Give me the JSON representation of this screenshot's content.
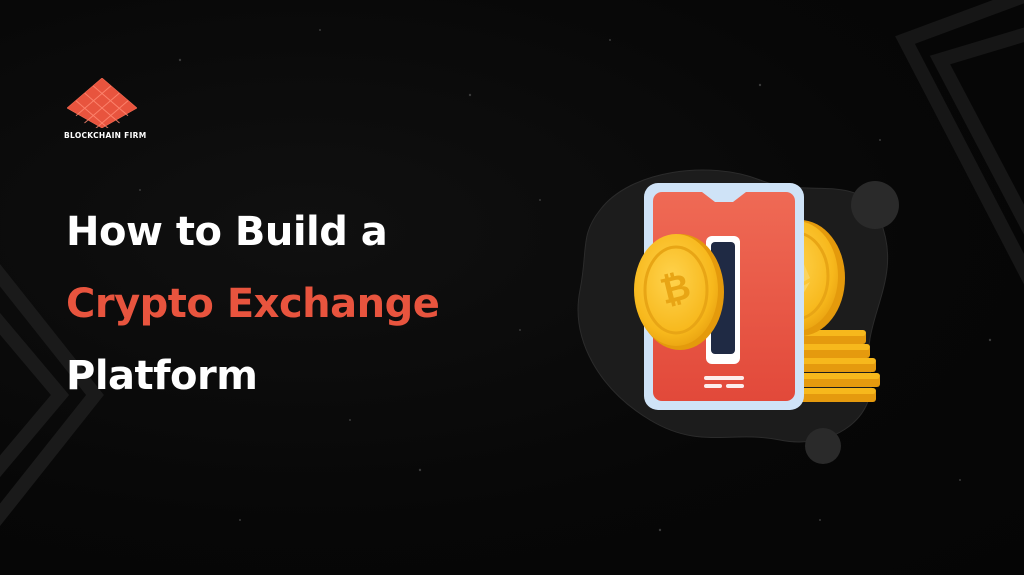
{
  "brand": {
    "name": "BLOCKCHAIN FIRM",
    "logo_icon": "diamond-grid-logo"
  },
  "headline": {
    "line1": "How to Build a",
    "line2": "Crypto Exchange",
    "line3": "Platform"
  },
  "illustration": {
    "phone_icon": "smartphone-icon",
    "front_coin_icon": "bitcoin-coin-icon",
    "back_coin_icon": "ethereum-coin-icon",
    "coin_stack_icon": "coin-stack-icon"
  },
  "colors": {
    "background": "#070707",
    "accent": "#e8543e",
    "text": "#ffffff",
    "coin_gold": "#f7b81c",
    "phone_frame": "#cfe3f7"
  }
}
